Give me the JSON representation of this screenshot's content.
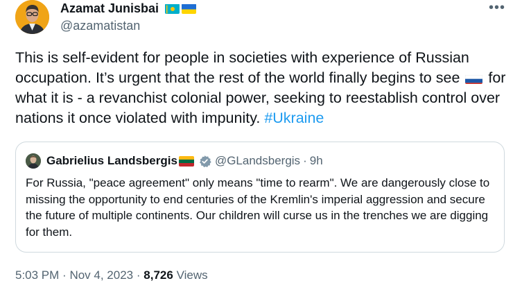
{
  "author": {
    "name": "Azamat Junisbai",
    "handle": "@azamatistan",
    "flags": [
      "kazakhstan-flag",
      "ukraine-flag"
    ]
  },
  "menu_icon": "more-icon",
  "tweet": {
    "text_part1": "This is self-evident for people in societies with experience of Russian occupation. It’s urgent that the rest of the world finally begins to see",
    "inline_flag": "russia-flag",
    "text_part2": "for what it is - a revanchist colonial power, seeking to reestablish control over nations it once violated with impunity.",
    "hashtag": "#Ukraine"
  },
  "quote": {
    "name": "Gabrielius Landsbergis",
    "flag": "lithuania-flag",
    "verified_icon": "verified-badge-icon",
    "handle": "@GLandsbergis",
    "dot": "·",
    "time": "9h",
    "text": "For Russia, \"peace agreement\" only means \"time to rearm\". We are dangerously close to missing the opportunity to end centuries of the Kremlin's imperial aggression and secure the future of multiple continents. Our children will curse us in the trenches we are digging for them."
  },
  "meta": {
    "time": "5:03 PM",
    "dot": "·",
    "date": "Nov 4, 2023",
    "views_count": "8,726",
    "views_label": "Views"
  },
  "colors": {
    "link": "#1d9bf0",
    "secondary_text": "#536471",
    "border": "#cfd9de",
    "avatar_bg": "#f0a417"
  }
}
